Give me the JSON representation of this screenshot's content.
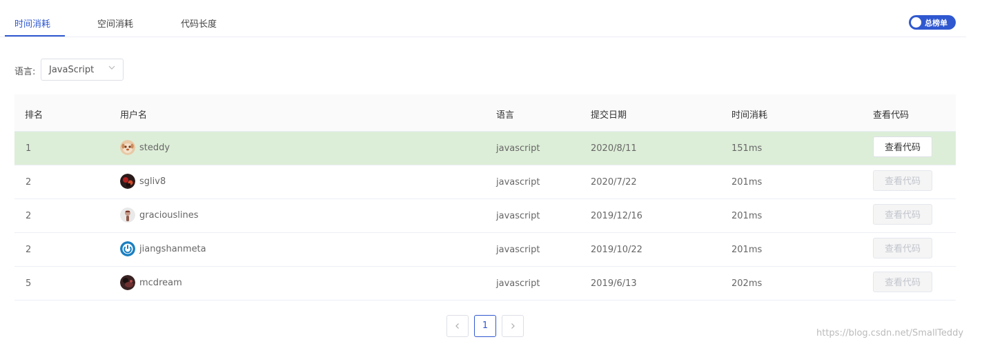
{
  "tabs": [
    {
      "label": "时间消耗",
      "active": true
    },
    {
      "label": "空间消耗",
      "active": false
    },
    {
      "label": "代码长度",
      "active": false
    }
  ],
  "toggle": {
    "label": "总榜单",
    "on": true
  },
  "filter": {
    "label": "语言:",
    "value": "JavaScript"
  },
  "table": {
    "headers": {
      "rank": "排名",
      "user": "用户名",
      "lang": "语言",
      "date": "提交日期",
      "time": "时间消耗",
      "code": "查看代码"
    },
    "rows": [
      {
        "rank": "1",
        "user": "steddy",
        "avatar": "dog-avatar",
        "lang": "javascript",
        "date": "2020/8/11",
        "time": "151ms",
        "button": "查看代码",
        "highlight": true,
        "enabled": true
      },
      {
        "rank": "2",
        "user": "sgliv8",
        "avatar": "dark-photo-avatar",
        "lang": "javascript",
        "date": "2020/7/22",
        "time": "201ms",
        "button": "查看代码",
        "highlight": false,
        "enabled": false
      },
      {
        "rank": "2",
        "user": "graciouslines",
        "avatar": "person-avatar",
        "lang": "javascript",
        "date": "2019/12/16",
        "time": "201ms",
        "button": "查看代码",
        "highlight": false,
        "enabled": false
      },
      {
        "rank": "2",
        "user": "jiangshanmeta",
        "avatar": "power-logo-avatar",
        "lang": "javascript",
        "date": "2019/10/22",
        "time": "201ms",
        "button": "查看代码",
        "highlight": false,
        "enabled": false
      },
      {
        "rank": "5",
        "user": "mcdream",
        "avatar": "dark-figure-avatar",
        "lang": "javascript",
        "date": "2019/6/13",
        "time": "202ms",
        "button": "查看代码",
        "highlight": false,
        "enabled": false
      }
    ]
  },
  "pagination": {
    "prev_icon": "chevron-left-icon",
    "next_icon": "chevron-right-icon",
    "current_page": "1"
  },
  "watermark": "https://blog.csdn.net/SmallTeddy",
  "colors": {
    "accent": "#2f58d0",
    "highlight_row": "#ddeed8"
  }
}
